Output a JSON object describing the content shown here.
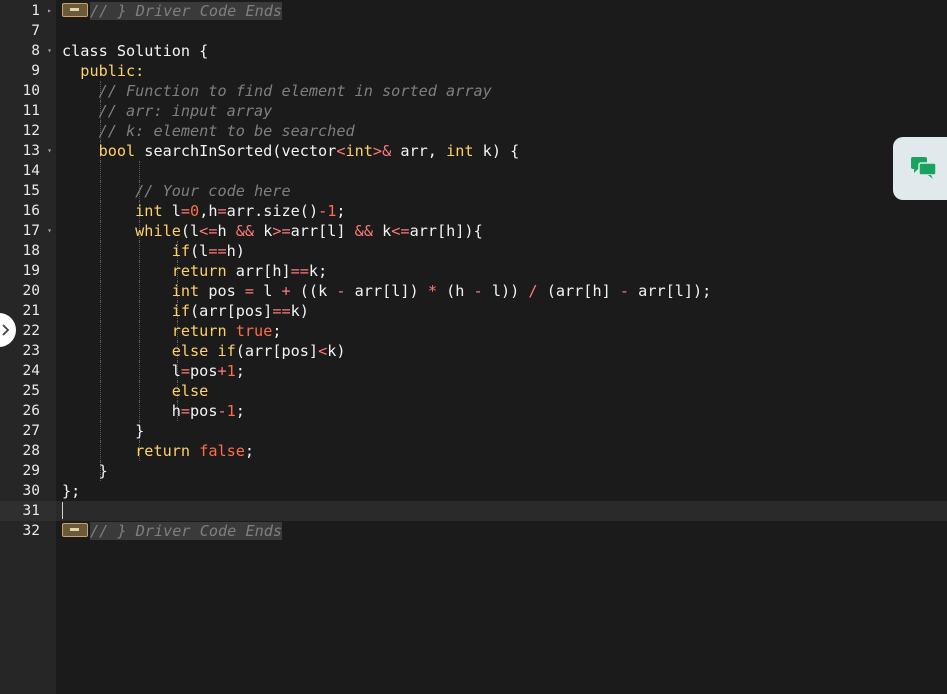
{
  "editor": {
    "colors": {
      "background": "#1b1b1b",
      "gutter": "#262626",
      "keyword": "#ffd166",
      "comment": "#7f7f7f",
      "number": "#ff6d4a",
      "operator": "#ff7a7a",
      "text": "#f3f3f3"
    },
    "active_line": "31",
    "lines": [
      {
        "num": "1",
        "fold": "right",
        "indent": 0,
        "tokens": [
          {
            "t": "fold",
            "v": ""
          },
          {
            "t": "cm",
            "v": "// } Driver Code Ends"
          }
        ]
      },
      {
        "num": "7",
        "fold": "",
        "indent": 0,
        "tokens": []
      },
      {
        "num": "8",
        "fold": "down",
        "indent": 0,
        "tokens": [
          {
            "t": "pl",
            "v": "class Solution {"
          }
        ]
      },
      {
        "num": "9",
        "fold": "",
        "indent": 0,
        "tokens": [
          {
            "t": "pl",
            "v": "  "
          },
          {
            "t": "kw",
            "v": "public:"
          }
        ]
      },
      {
        "num": "10",
        "fold": "",
        "indent": 1,
        "tokens": [
          {
            "t": "pl",
            "v": "    "
          },
          {
            "t": "cm",
            "v": "// Function to find element in sorted array"
          }
        ]
      },
      {
        "num": "11",
        "fold": "",
        "indent": 1,
        "tokens": [
          {
            "t": "pl",
            "v": "    "
          },
          {
            "t": "cm",
            "v": "// arr: input array"
          }
        ]
      },
      {
        "num": "12",
        "fold": "",
        "indent": 1,
        "tokens": [
          {
            "t": "pl",
            "v": "    "
          },
          {
            "t": "cm",
            "v": "// k: element to be searched"
          }
        ]
      },
      {
        "num": "13",
        "fold": "down",
        "indent": 1,
        "tokens": [
          {
            "t": "pl",
            "v": "    "
          },
          {
            "t": "kw",
            "v": "bool"
          },
          {
            "t": "pl",
            "v": " searchInSorted(vector"
          },
          {
            "t": "op",
            "v": "<"
          },
          {
            "t": "kw",
            "v": "int"
          },
          {
            "t": "op",
            "v": ">&"
          },
          {
            "t": "pl",
            "v": " arr, "
          },
          {
            "t": "kw",
            "v": "int"
          },
          {
            "t": "pl",
            "v": " k) {"
          }
        ]
      },
      {
        "num": "14",
        "fold": "",
        "indent": 2,
        "tokens": []
      },
      {
        "num": "15",
        "fold": "",
        "indent": 2,
        "tokens": [
          {
            "t": "pl",
            "v": "        "
          },
          {
            "t": "cm",
            "v": "// Your code here"
          }
        ]
      },
      {
        "num": "16",
        "fold": "",
        "indent": 2,
        "tokens": [
          {
            "t": "pl",
            "v": "        "
          },
          {
            "t": "kw",
            "v": "int"
          },
          {
            "t": "pl",
            "v": " l"
          },
          {
            "t": "op",
            "v": "="
          },
          {
            "t": "nm",
            "v": "0"
          },
          {
            "t": "pl",
            "v": ",h"
          },
          {
            "t": "op",
            "v": "="
          },
          {
            "t": "pl",
            "v": "arr.size()"
          },
          {
            "t": "op",
            "v": "-"
          },
          {
            "t": "nm",
            "v": "1"
          },
          {
            "t": "pl",
            "v": ";"
          }
        ]
      },
      {
        "num": "17",
        "fold": "down",
        "indent": 2,
        "tokens": [
          {
            "t": "pl",
            "v": "        "
          },
          {
            "t": "kw",
            "v": "while"
          },
          {
            "t": "pl",
            "v": "(l"
          },
          {
            "t": "op",
            "v": "<="
          },
          {
            "t": "pl",
            "v": "h "
          },
          {
            "t": "op",
            "v": "&&"
          },
          {
            "t": "pl",
            "v": " k"
          },
          {
            "t": "op",
            "v": ">="
          },
          {
            "t": "pl",
            "v": "arr[l] "
          },
          {
            "t": "op",
            "v": "&&"
          },
          {
            "t": "pl",
            "v": " k"
          },
          {
            "t": "op",
            "v": "<="
          },
          {
            "t": "pl",
            "v": "arr[h]){"
          }
        ]
      },
      {
        "num": "18",
        "fold": "",
        "indent": 3,
        "tokens": [
          {
            "t": "pl",
            "v": "            "
          },
          {
            "t": "kw",
            "v": "if"
          },
          {
            "t": "pl",
            "v": "(l"
          },
          {
            "t": "op",
            "v": "=="
          },
          {
            "t": "pl",
            "v": "h)"
          }
        ]
      },
      {
        "num": "19",
        "fold": "",
        "indent": 3,
        "tokens": [
          {
            "t": "pl",
            "v": "            "
          },
          {
            "t": "kw",
            "v": "return"
          },
          {
            "t": "pl",
            "v": " arr[h]"
          },
          {
            "t": "op",
            "v": "=="
          },
          {
            "t": "pl",
            "v": "k;"
          }
        ]
      },
      {
        "num": "20",
        "fold": "",
        "indent": 3,
        "tokens": [
          {
            "t": "pl",
            "v": "            "
          },
          {
            "t": "kw",
            "v": "int"
          },
          {
            "t": "pl",
            "v": " pos "
          },
          {
            "t": "op",
            "v": "="
          },
          {
            "t": "pl",
            "v": " l "
          },
          {
            "t": "op",
            "v": "+"
          },
          {
            "t": "pl",
            "v": " ((k "
          },
          {
            "t": "op",
            "v": "-"
          },
          {
            "t": "pl",
            "v": " arr[l]) "
          },
          {
            "t": "op",
            "v": "*"
          },
          {
            "t": "pl",
            "v": " (h "
          },
          {
            "t": "op",
            "v": "-"
          },
          {
            "t": "pl",
            "v": " l)) "
          },
          {
            "t": "op",
            "v": "/"
          },
          {
            "t": "pl",
            "v": " (arr[h] "
          },
          {
            "t": "op",
            "v": "-"
          },
          {
            "t": "pl",
            "v": " arr[l]);"
          }
        ]
      },
      {
        "num": "21",
        "fold": "",
        "indent": 3,
        "tokens": [
          {
            "t": "pl",
            "v": "            "
          },
          {
            "t": "kw",
            "v": "if"
          },
          {
            "t": "pl",
            "v": "(arr[pos]"
          },
          {
            "t": "op",
            "v": "=="
          },
          {
            "t": "pl",
            "v": "k)"
          }
        ]
      },
      {
        "num": "22",
        "fold": "",
        "indent": 3,
        "tokens": [
          {
            "t": "pl",
            "v": "            "
          },
          {
            "t": "kw",
            "v": "return"
          },
          {
            "t": "pl",
            "v": " "
          },
          {
            "t": "nm",
            "v": "true"
          },
          {
            "t": "pl",
            "v": ";"
          }
        ]
      },
      {
        "num": "23",
        "fold": "",
        "indent": 3,
        "tokens": [
          {
            "t": "pl",
            "v": "            "
          },
          {
            "t": "kw",
            "v": "else"
          },
          {
            "t": "pl",
            "v": " "
          },
          {
            "t": "kw",
            "v": "if"
          },
          {
            "t": "pl",
            "v": "(arr[pos]"
          },
          {
            "t": "op",
            "v": "<"
          },
          {
            "t": "pl",
            "v": "k)"
          }
        ]
      },
      {
        "num": "24",
        "fold": "",
        "indent": 3,
        "tokens": [
          {
            "t": "pl",
            "v": "            l"
          },
          {
            "t": "op",
            "v": "="
          },
          {
            "t": "pl",
            "v": "pos"
          },
          {
            "t": "op",
            "v": "+"
          },
          {
            "t": "nm",
            "v": "1"
          },
          {
            "t": "pl",
            "v": ";"
          }
        ]
      },
      {
        "num": "25",
        "fold": "",
        "indent": 3,
        "tokens": [
          {
            "t": "pl",
            "v": "            "
          },
          {
            "t": "kw",
            "v": "else"
          }
        ]
      },
      {
        "num": "26",
        "fold": "",
        "indent": 3,
        "tokens": [
          {
            "t": "pl",
            "v": "            h"
          },
          {
            "t": "op",
            "v": "="
          },
          {
            "t": "pl",
            "v": "pos"
          },
          {
            "t": "op",
            "v": "-"
          },
          {
            "t": "nm",
            "v": "1"
          },
          {
            "t": "pl",
            "v": ";"
          }
        ]
      },
      {
        "num": "27",
        "fold": "",
        "indent": 2,
        "tokens": [
          {
            "t": "pl",
            "v": "        }"
          }
        ]
      },
      {
        "num": "28",
        "fold": "",
        "indent": 2,
        "tokens": [
          {
            "t": "pl",
            "v": "        "
          },
          {
            "t": "kw",
            "v": "return"
          },
          {
            "t": "pl",
            "v": " "
          },
          {
            "t": "nm",
            "v": "false"
          },
          {
            "t": "pl",
            "v": ";"
          }
        ]
      },
      {
        "num": "29",
        "fold": "",
        "indent": 1,
        "tokens": [
          {
            "t": "pl",
            "v": "    }"
          }
        ]
      },
      {
        "num": "30",
        "fold": "",
        "indent": 0,
        "tokens": [
          {
            "t": "pl",
            "v": "};"
          }
        ]
      },
      {
        "num": "31",
        "fold": "",
        "indent": 0,
        "tokens": []
      },
      {
        "num": "32",
        "fold": "",
        "indent": 0,
        "tokens": [
          {
            "t": "fold",
            "v": ""
          },
          {
            "t": "cm",
            "v": "// } Driver Code Ends"
          }
        ]
      }
    ]
  },
  "widgets": {
    "chat_icon": "chat-bubbles-icon",
    "toggle_icon": "chevron-right-icon"
  }
}
